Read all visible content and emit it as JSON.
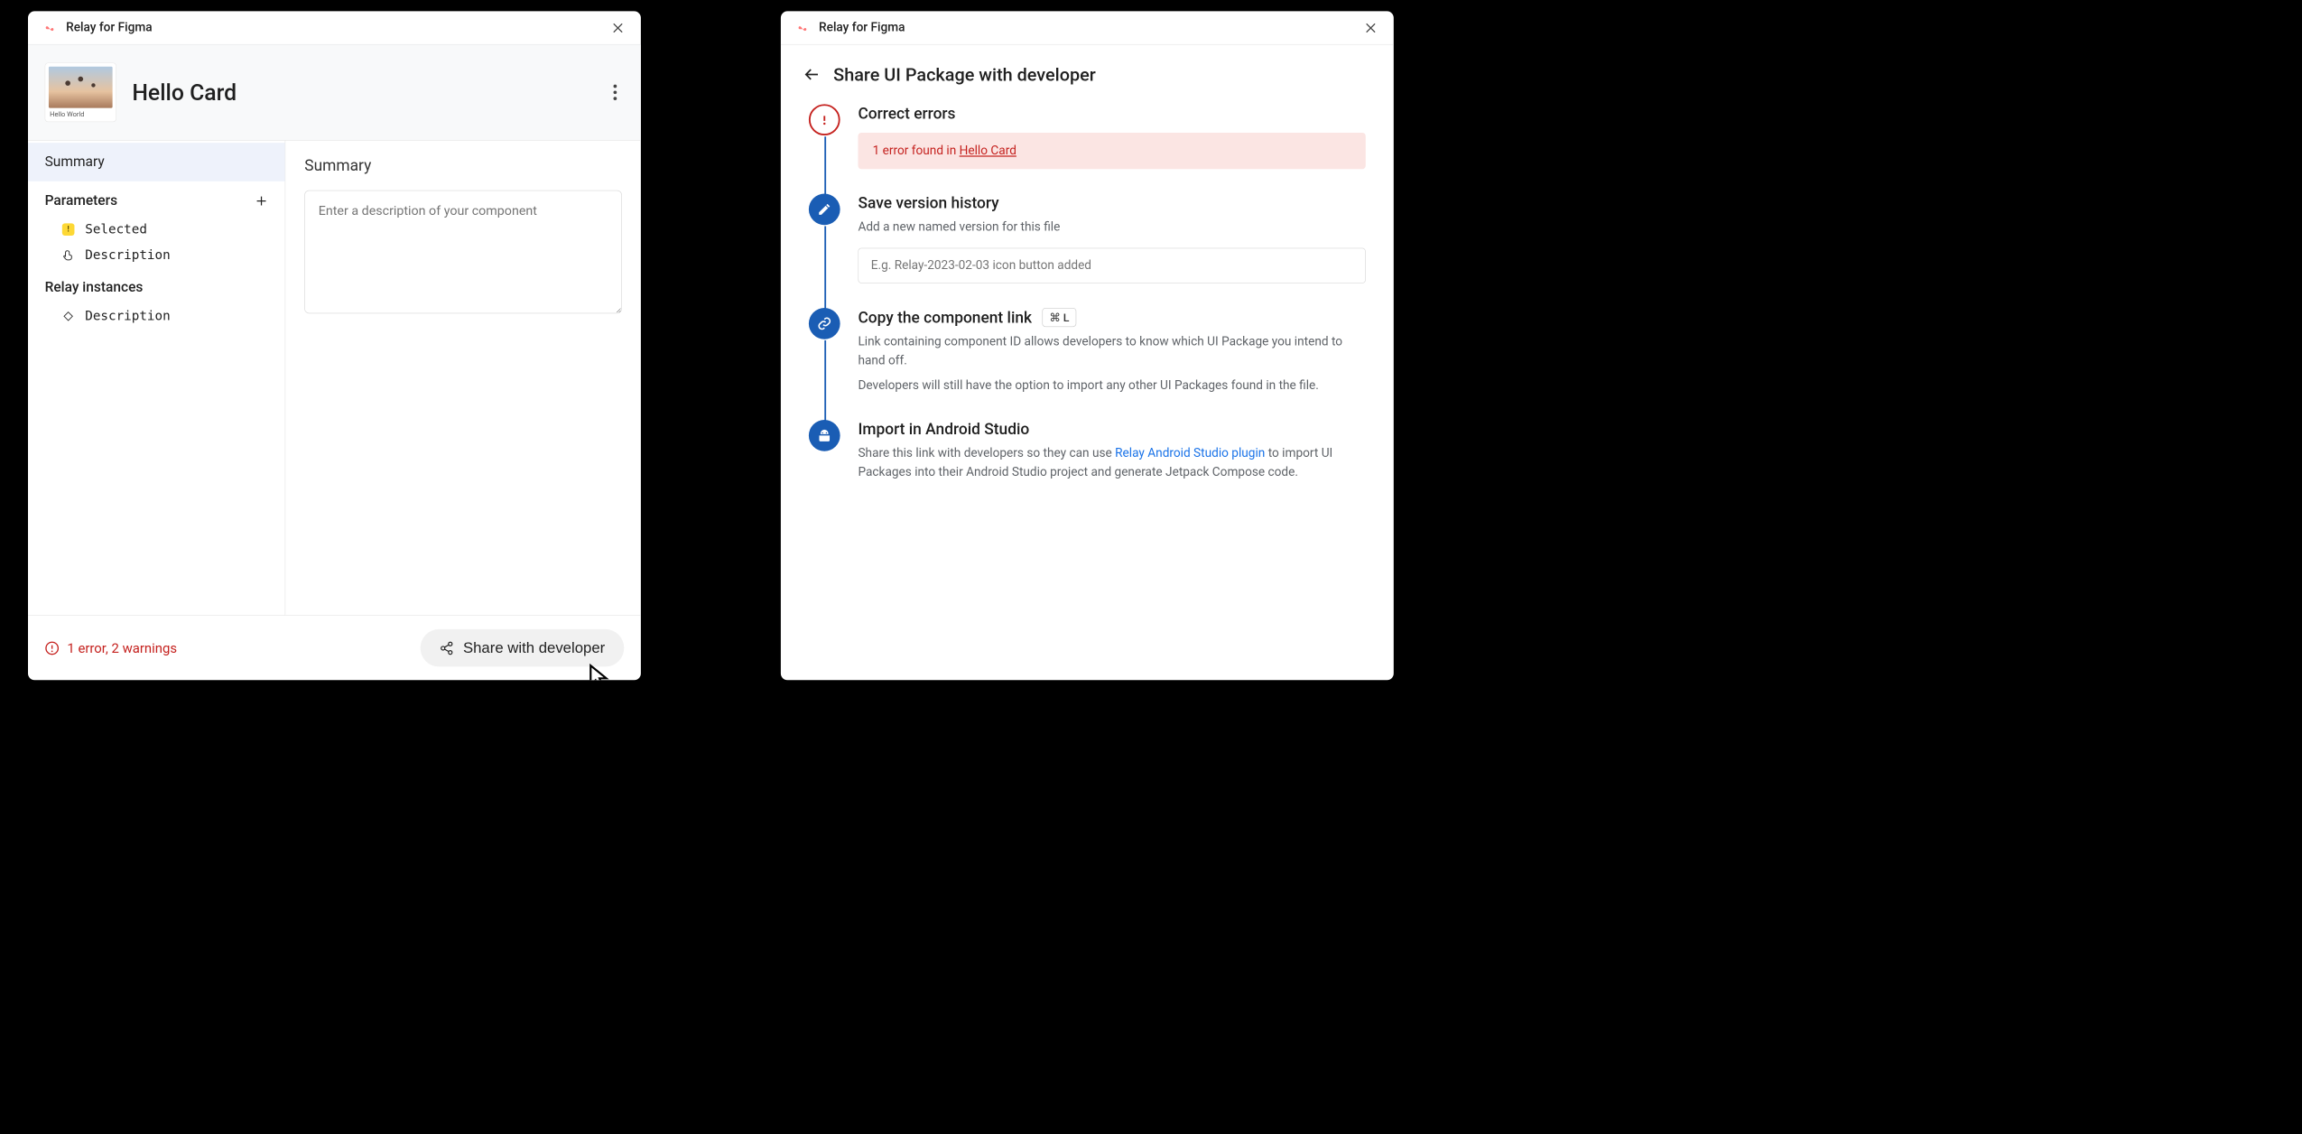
{
  "left": {
    "app_title": "Relay for Figma",
    "card": {
      "thumb_caption": "Hello World",
      "title": "Hello Card"
    },
    "sidebar": {
      "summary": "Summary",
      "parameters": "Parameters",
      "param_items": [
        "Selected",
        "Description"
      ],
      "relay_instances": "Relay instances",
      "instance_items": [
        "Description"
      ]
    },
    "content": {
      "heading": "Summary",
      "placeholder": "Enter a description of your component"
    },
    "footer": {
      "status": "1 error, 2 warnings",
      "share_label": "Share with developer"
    }
  },
  "right": {
    "app_title": "Relay for Figma",
    "page_title": "Share UI Package with developer",
    "steps": {
      "errors": {
        "title": "Correct errors",
        "banner_prefix": "1 error found in ",
        "banner_link": "Hello Card"
      },
      "save": {
        "title": "Save version history",
        "sub": "Add a new named version for this file",
        "placeholder": "E.g. Relay-2023-02-03 icon button added"
      },
      "copy": {
        "title": "Copy the component link",
        "kbd": "⌘ L",
        "sub1": "Link containing component ID allows developers to know which UI Package you intend to hand off.",
        "sub2": "Developers will still have the option to import any other UI Packages found in the file."
      },
      "import": {
        "title": "Import in Android Studio",
        "sub_prefix": "Share this link with developers so they can use ",
        "sub_link": "Relay Android Studio plugin",
        "sub_suffix": " to import UI Packages into their Android Studio project and generate Jetpack Compose code."
      }
    }
  }
}
